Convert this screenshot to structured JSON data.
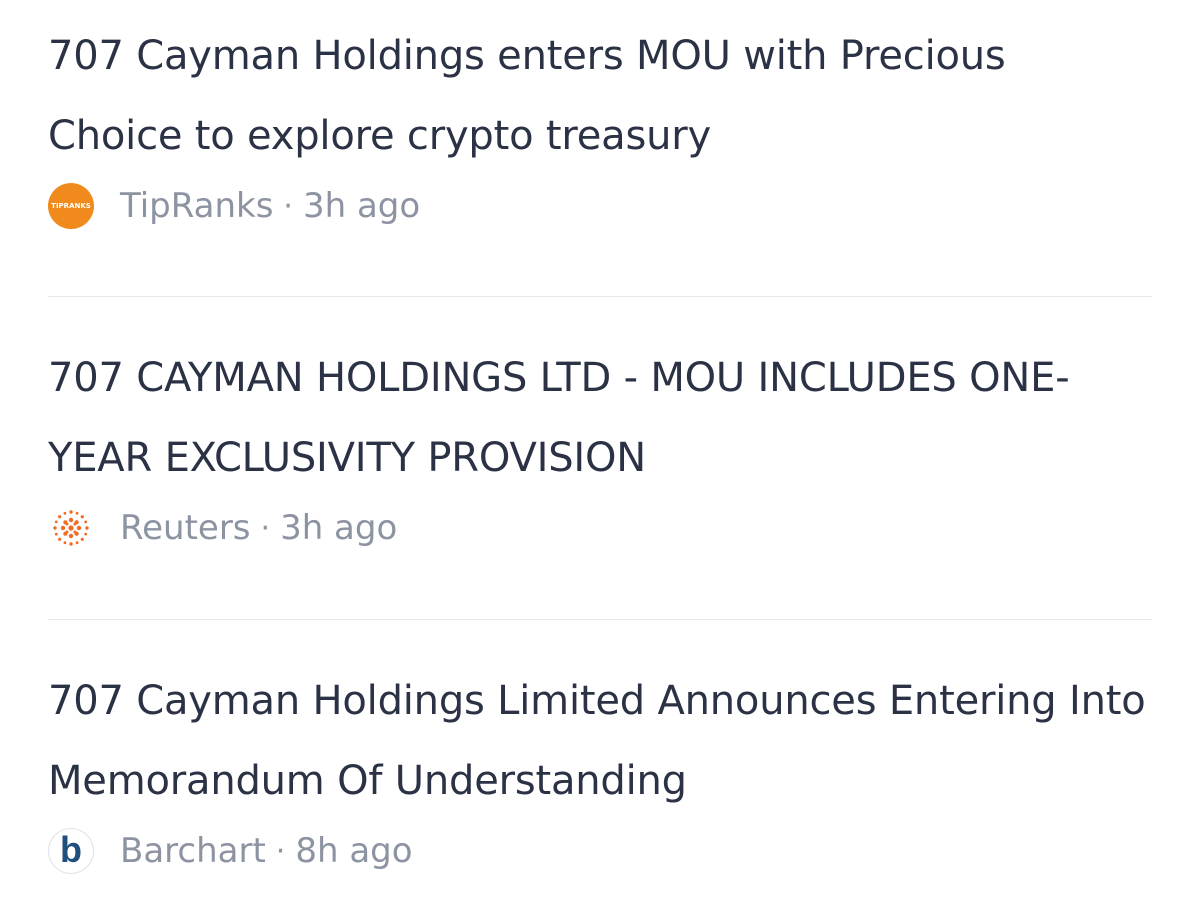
{
  "news": {
    "items": [
      {
        "headline": "707 Cayman Holdings enters MOU with Precious Choice to explore crypto treasury",
        "source": "TipRanks",
        "separator": "·",
        "time": "3h ago",
        "logo_text": "TIPRANKS",
        "logo_color": "#f08a1c"
      },
      {
        "headline": "707 CAYMAN HOLDINGS LTD - MOU INCLUDES ONE-YEAR EXCLUSIVITY PROVISION",
        "source": "Reuters",
        "separator": "·",
        "time": "3h ago",
        "logo_color": "#f26b21"
      },
      {
        "headline": "707 Cayman Holdings Limited Announces Entering Into Memorandum Of Understanding",
        "source": "Barchart",
        "separator": "·",
        "time": "8h ago",
        "logo_text": "b",
        "logo_color": "#1f4f7d"
      }
    ]
  },
  "colors": {
    "headline": "#2b3245",
    "meta": "#8c93a1",
    "divider": "#e6e8ec"
  }
}
